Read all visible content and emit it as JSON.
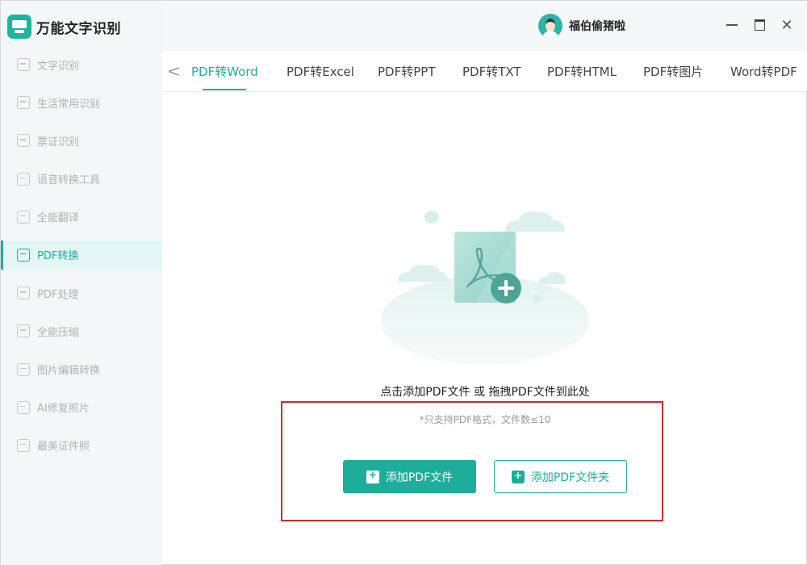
{
  "app": {
    "title": "万能文字识别"
  },
  "user": {
    "name": "福伯偷猪啦"
  },
  "window_controls": {
    "minimize": "—",
    "maximize": "□",
    "close": "✕"
  },
  "sidebar": {
    "items": [
      {
        "label": "文字识别",
        "icon": "scan-text-icon",
        "active": false
      },
      {
        "label": "生活常用识别",
        "icon": "scan-life-icon",
        "active": false
      },
      {
        "label": "票证识别",
        "icon": "scan-ticket-icon",
        "active": false
      },
      {
        "label": "语音转换工具",
        "icon": "audio-convert-icon",
        "active": false
      },
      {
        "label": "全能翻译",
        "icon": "translate-icon",
        "active": false
      },
      {
        "label": "PDF转换",
        "icon": "pdf-convert-icon",
        "active": true
      },
      {
        "label": "PDF处理",
        "icon": "pdf-process-icon",
        "active": false
      },
      {
        "label": "全能压缩",
        "icon": "compress-icon",
        "active": false
      },
      {
        "label": "图片编辑转换",
        "icon": "image-edit-icon",
        "active": false
      },
      {
        "label": "AI修复照片",
        "icon": "ai-repair-icon",
        "active": false
      },
      {
        "label": "最美证件照",
        "icon": "id-photo-icon",
        "active": false
      }
    ]
  },
  "tabs": {
    "back": "<",
    "items": [
      {
        "label": "PDF转Word",
        "active": true
      },
      {
        "label": "PDF转Excel",
        "active": false
      },
      {
        "label": "PDF转PPT",
        "active": false
      },
      {
        "label": "PDF转TXT",
        "active": false
      },
      {
        "label": "PDF转HTML",
        "active": false
      },
      {
        "label": "PDF转图片",
        "active": false
      },
      {
        "label": "Word转PDF",
        "active": false
      }
    ]
  },
  "main": {
    "drop_text": "点击添加PDF文件 或 拖拽PDF文件到此处",
    "hint": "*只支持PDF格式，文件数≤10",
    "add_file_button": "添加PDF文件",
    "add_folder_button": "添加PDF文件夹"
  },
  "colors": {
    "accent": "#1cae9b",
    "highlight": "#cc2a2a"
  }
}
